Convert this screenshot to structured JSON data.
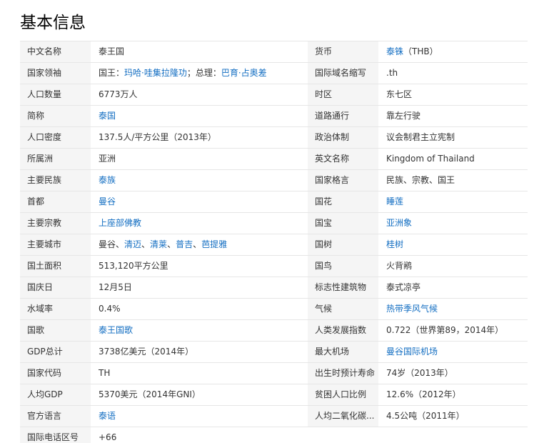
{
  "title": "基本信息",
  "rows": [
    {
      "l": "中文名称",
      "v": [
        {
          "t": "泰王国"
        }
      ],
      "r": "货币",
      "w": [
        {
          "t": "泰铢",
          "link": true
        },
        {
          "t": "（THB）"
        }
      ]
    },
    {
      "l": "国家领袖",
      "v": [
        {
          "t": "国王："
        },
        {
          "t": "玛哈·哇集拉隆功",
          "link": true
        },
        {
          "t": "；总理："
        },
        {
          "t": "巴育·占奥差",
          "link": true
        }
      ],
      "r": "国际域名缩写",
      "w": [
        {
          "t": ".th"
        }
      ]
    },
    {
      "l": "人口数量",
      "v": [
        {
          "t": "6773万人"
        }
      ],
      "r": "时区",
      "w": [
        {
          "t": "东七区"
        }
      ]
    },
    {
      "l": "简称",
      "v": [
        {
          "t": "泰国",
          "link": true
        }
      ],
      "r": "道路通行",
      "w": [
        {
          "t": "靠左行驶"
        }
      ]
    },
    {
      "l": "人口密度",
      "v": [
        {
          "t": "137.5人/平方公里（2013年）"
        }
      ],
      "r": "政治体制",
      "w": [
        {
          "t": "议会制君主立宪制"
        }
      ]
    },
    {
      "l": "所属洲",
      "v": [
        {
          "t": "亚洲"
        }
      ],
      "r": "英文名称",
      "w": [
        {
          "t": "Kingdom of Thailand"
        }
      ]
    },
    {
      "l": "主要民族",
      "v": [
        {
          "t": "泰族",
          "link": true
        }
      ],
      "r": "国家格言",
      "w": [
        {
          "t": "民族、宗教、国王"
        }
      ]
    },
    {
      "l": "首都",
      "v": [
        {
          "t": "曼谷",
          "link": true
        }
      ],
      "r": "国花",
      "w": [
        {
          "t": "睡莲",
          "link": true
        }
      ]
    },
    {
      "l": "主要宗教",
      "v": [
        {
          "t": "上座部佛教",
          "link": true
        }
      ],
      "r": "国宝",
      "w": [
        {
          "t": "亚洲象",
          "link": true
        }
      ]
    },
    {
      "l": "主要城市",
      "v": [
        {
          "t": "曼谷、"
        },
        {
          "t": "清迈",
          "link": true
        },
        {
          "t": "、"
        },
        {
          "t": "清莱",
          "link": true
        },
        {
          "t": "、"
        },
        {
          "t": "普吉",
          "link": true
        },
        {
          "t": "、"
        },
        {
          "t": "芭提雅",
          "link": true
        }
      ],
      "r": "国树",
      "w": [
        {
          "t": "桂树",
          "link": true
        }
      ]
    },
    {
      "l": "国土面积",
      "v": [
        {
          "t": "513,120平方公里"
        }
      ],
      "r": "国鸟",
      "w": [
        {
          "t": "火背鹇"
        }
      ]
    },
    {
      "l": "国庆日",
      "v": [
        {
          "t": "12月5日"
        }
      ],
      "r": "标志性建筑物",
      "w": [
        {
          "t": "泰式凉亭"
        }
      ]
    },
    {
      "l": "水域率",
      "v": [
        {
          "t": "0.4%"
        }
      ],
      "r": "气候",
      "w": [
        {
          "t": "热带季风气候",
          "link": true
        }
      ]
    },
    {
      "l": "国歌",
      "v": [
        {
          "t": "泰王国歌",
          "link": true
        }
      ],
      "r": "人类发展指数",
      "w": [
        {
          "t": "0.722（世界第89，2014年）"
        }
      ]
    },
    {
      "l": "GDP总计",
      "v": [
        {
          "t": "3738亿美元（2014年）"
        }
      ],
      "r": "最大机场",
      "w": [
        {
          "t": "曼谷国际机场",
          "link": true
        }
      ]
    },
    {
      "l": "国家代码",
      "v": [
        {
          "t": "TH"
        }
      ],
      "r": "出生时预计寿命",
      "w": [
        {
          "t": "74岁（2013年）"
        }
      ]
    },
    {
      "l": "人均GDP",
      "v": [
        {
          "t": "5370美元（2014年GNI）"
        }
      ],
      "r": "贫困人口比例",
      "w": [
        {
          "t": "12.6%（2012年）"
        }
      ]
    },
    {
      "l": "官方语言",
      "v": [
        {
          "t": "泰语",
          "link": true
        }
      ],
      "r": "人均二氧化碳...",
      "w": [
        {
          "t": "4.5公吨（2011年）"
        }
      ]
    },
    {
      "l": "国际电话区号",
      "v": [
        {
          "t": "+66"
        }
      ],
      "r": "",
      "w": []
    }
  ]
}
